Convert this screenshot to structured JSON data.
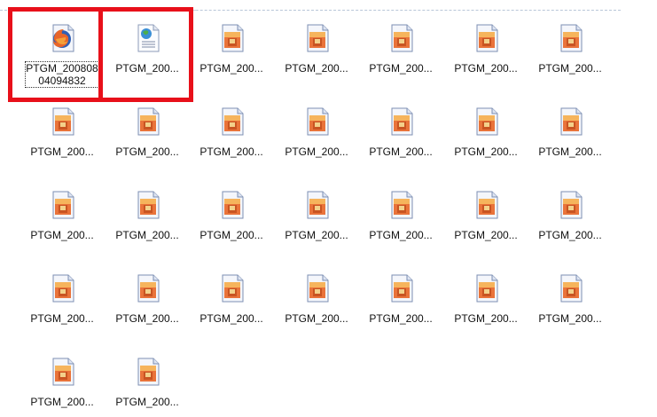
{
  "files": [
    {
      "name": "PTGM_20080804094832",
      "label": "PTGM_20080804094832",
      "icon": "firefox-html-file-icon",
      "selected": true
    },
    {
      "name": "PTGM_200...",
      "label": "PTGM_200...",
      "icon": "web-document-file-icon",
      "selected": false
    },
    {
      "name": "PTGM_200...",
      "label": "PTGM_200...",
      "icon": "image-file-icon",
      "selected": false
    },
    {
      "name": "PTGM_200...",
      "label": "PTGM_200...",
      "icon": "image-file-icon",
      "selected": false
    },
    {
      "name": "PTGM_200...",
      "label": "PTGM_200...",
      "icon": "image-file-icon",
      "selected": false
    },
    {
      "name": "PTGM_200...",
      "label": "PTGM_200...",
      "icon": "image-file-icon",
      "selected": false
    },
    {
      "name": "PTGM_200...",
      "label": "PTGM_200...",
      "icon": "image-file-icon",
      "selected": false
    },
    {
      "name": "PTGM_200...",
      "label": "PTGM_200...",
      "icon": "image-file-icon",
      "selected": false
    },
    {
      "name": "PTGM_200...",
      "label": "PTGM_200...",
      "icon": "image-file-icon",
      "selected": false
    },
    {
      "name": "PTGM_200...",
      "label": "PTGM_200...",
      "icon": "image-file-icon",
      "selected": false
    },
    {
      "name": "PTGM_200...",
      "label": "PTGM_200...",
      "icon": "image-file-icon",
      "selected": false
    },
    {
      "name": "PTGM_200...",
      "label": "PTGM_200...",
      "icon": "image-file-icon",
      "selected": false
    },
    {
      "name": "PTGM_200...",
      "label": "PTGM_200...",
      "icon": "image-file-icon",
      "selected": false
    },
    {
      "name": "PTGM_200...",
      "label": "PTGM_200...",
      "icon": "image-file-icon",
      "selected": false
    },
    {
      "name": "PTGM_200...",
      "label": "PTGM_200...",
      "icon": "image-file-icon",
      "selected": false
    },
    {
      "name": "PTGM_200...",
      "label": "PTGM_200...",
      "icon": "image-file-icon",
      "selected": false
    },
    {
      "name": "PTGM_200...",
      "label": "PTGM_200...",
      "icon": "image-file-icon",
      "selected": false
    },
    {
      "name": "PTGM_200...",
      "label": "PTGM_200...",
      "icon": "image-file-icon",
      "selected": false
    },
    {
      "name": "PTGM_200...",
      "label": "PTGM_200...",
      "icon": "image-file-icon",
      "selected": false
    },
    {
      "name": "PTGM_200...",
      "label": "PTGM_200...",
      "icon": "image-file-icon",
      "selected": false
    },
    {
      "name": "PTGM_200...",
      "label": "PTGM_200...",
      "icon": "image-file-icon",
      "selected": false
    },
    {
      "name": "PTGM_200...",
      "label": "PTGM_200...",
      "icon": "image-file-icon",
      "selected": false
    },
    {
      "name": "PTGM_200...",
      "label": "PTGM_200...",
      "icon": "image-file-icon",
      "selected": false
    },
    {
      "name": "PTGM_200...",
      "label": "PTGM_200...",
      "icon": "image-file-icon",
      "selected": false
    },
    {
      "name": "PTGM_200...",
      "label": "PTGM_200...",
      "icon": "image-file-icon",
      "selected": false
    },
    {
      "name": "PTGM_200...",
      "label": "PTGM_200...",
      "icon": "image-file-icon",
      "selected": false
    },
    {
      "name": "PTGM_200...",
      "label": "PTGM_200...",
      "icon": "image-file-icon",
      "selected": false
    },
    {
      "name": "PTGM_200...",
      "label": "PTGM_200...",
      "icon": "image-file-icon",
      "selected": false
    },
    {
      "name": "PTGM_200...",
      "label": "PTGM_200...",
      "icon": "image-file-icon",
      "selected": false
    },
    {
      "name": "PTGM_200...",
      "label": "PTGM_200...",
      "icon": "image-file-icon",
      "selected": false
    }
  ],
  "highlight_color": "#e8101a",
  "label_color": "#111111"
}
